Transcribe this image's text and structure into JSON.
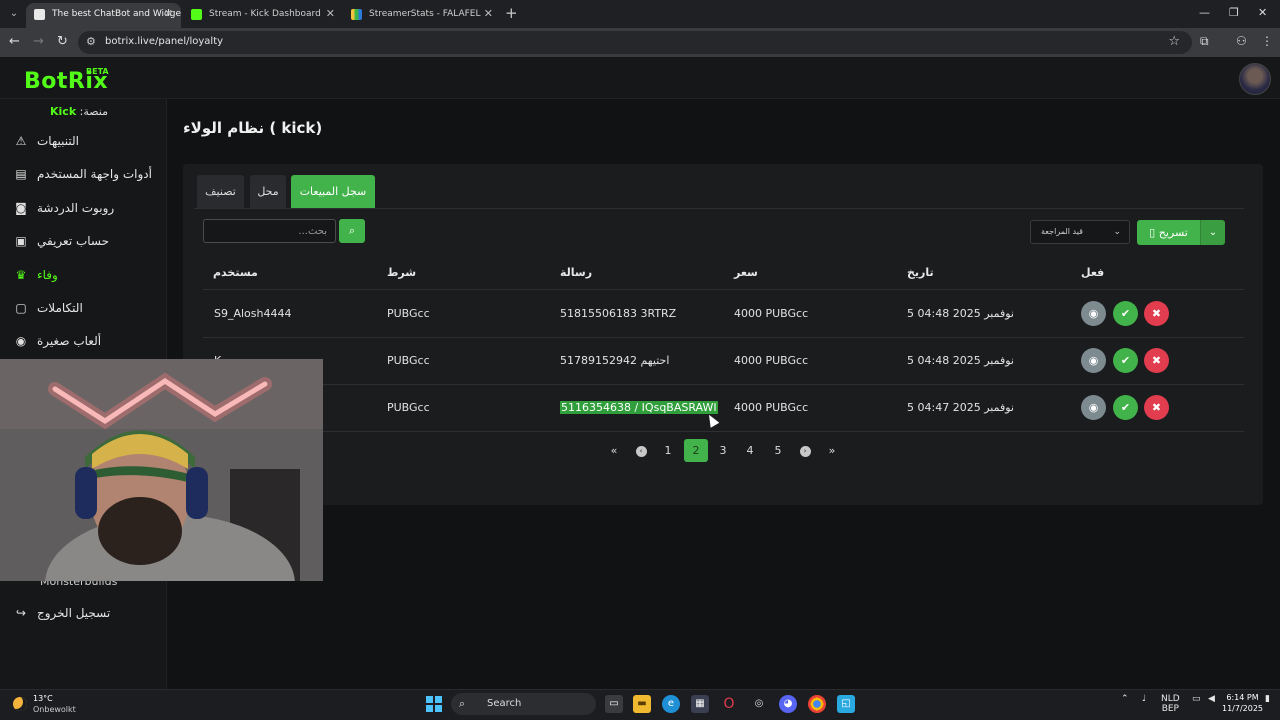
{
  "browser": {
    "tabs": [
      {
        "title": "The best ChatBot and Widgets",
        "active": true
      },
      {
        "title": "Stream - Kick Dashboard",
        "active": false
      },
      {
        "title": "StreamerStats - FALAFELCO Pro",
        "active": false
      }
    ],
    "url": "botrix.live/panel/loyalty",
    "icons": {
      "back": "arrow-left-icon",
      "forward": "arrow-right-icon",
      "reload": "reload-icon",
      "bookmark": "star-icon"
    }
  },
  "app": {
    "logo": "BotRix",
    "beta": "BETA",
    "platform_label": "منصة:",
    "platform_name": "Kick",
    "accent": "#53fc18"
  },
  "sidebar": {
    "items": [
      {
        "label": "التنبيهات",
        "icon": "warning-icon"
      },
      {
        "label": "أدوات واجهة المستخدم",
        "icon": "widgets-icon"
      },
      {
        "label": "روبوت الدردشة",
        "icon": "robot-icon"
      },
      {
        "label": "حساب تعريفي",
        "icon": "id-card-icon"
      },
      {
        "label": "وفاء",
        "icon": "trophy-icon",
        "active": true
      },
      {
        "label": "التكاملات",
        "icon": "integrations-icon"
      },
      {
        "label": "ألعاب صغيرة",
        "icon": "gamepad-icon"
      }
    ],
    "partial_item": "Monsterbuilds",
    "logout": "تسجيل الخروج"
  },
  "page": {
    "title": "نظام الولاء ( kick)"
  },
  "tabs": [
    {
      "label": "سجل المبيعات",
      "active": true
    },
    {
      "label": "محل",
      "active": false
    },
    {
      "label": "تصنيف",
      "active": false
    }
  ],
  "toolbar": {
    "search_placeholder": "بحث...",
    "filter_selected": "قيد المراجعة",
    "export_label": "تسريح"
  },
  "table": {
    "headers": {
      "user": "مستخدم",
      "condition": "شرط",
      "message": "رسالة",
      "price": "سعر",
      "date": "تاريخ",
      "action": "فعل"
    },
    "rows": [
      {
        "user": "S9_Alosh4444",
        "condition": "PUBGcc",
        "message": "51815506183 3RTRZ",
        "price": "4000 PUBGcc",
        "date": "5 نوفمبر 2025 04:48"
      },
      {
        "user": "K",
        "condition": "PUBGcc",
        "message": "51789152942 احتيهم",
        "price": "4000 PUBGcc",
        "date": "5 نوفمبر 2025 04:48"
      },
      {
        "user": "",
        "condition": "PUBGcc",
        "message": "5116354638 / IQsqBASRAWI",
        "price": "4000 PUBGcc",
        "date": "5 نوفمبر 2025 04:47"
      }
    ]
  },
  "pagination": {
    "pages": [
      "1",
      "2",
      "3",
      "4",
      "5"
    ],
    "current": "2"
  },
  "taskbar": {
    "temperature": "13°C",
    "weather": "Onbewolkt",
    "search": "Search",
    "lang_top": "NLD",
    "lang_bottom": "BEP",
    "time": "6:14 PM",
    "date": "11/7/2025"
  }
}
